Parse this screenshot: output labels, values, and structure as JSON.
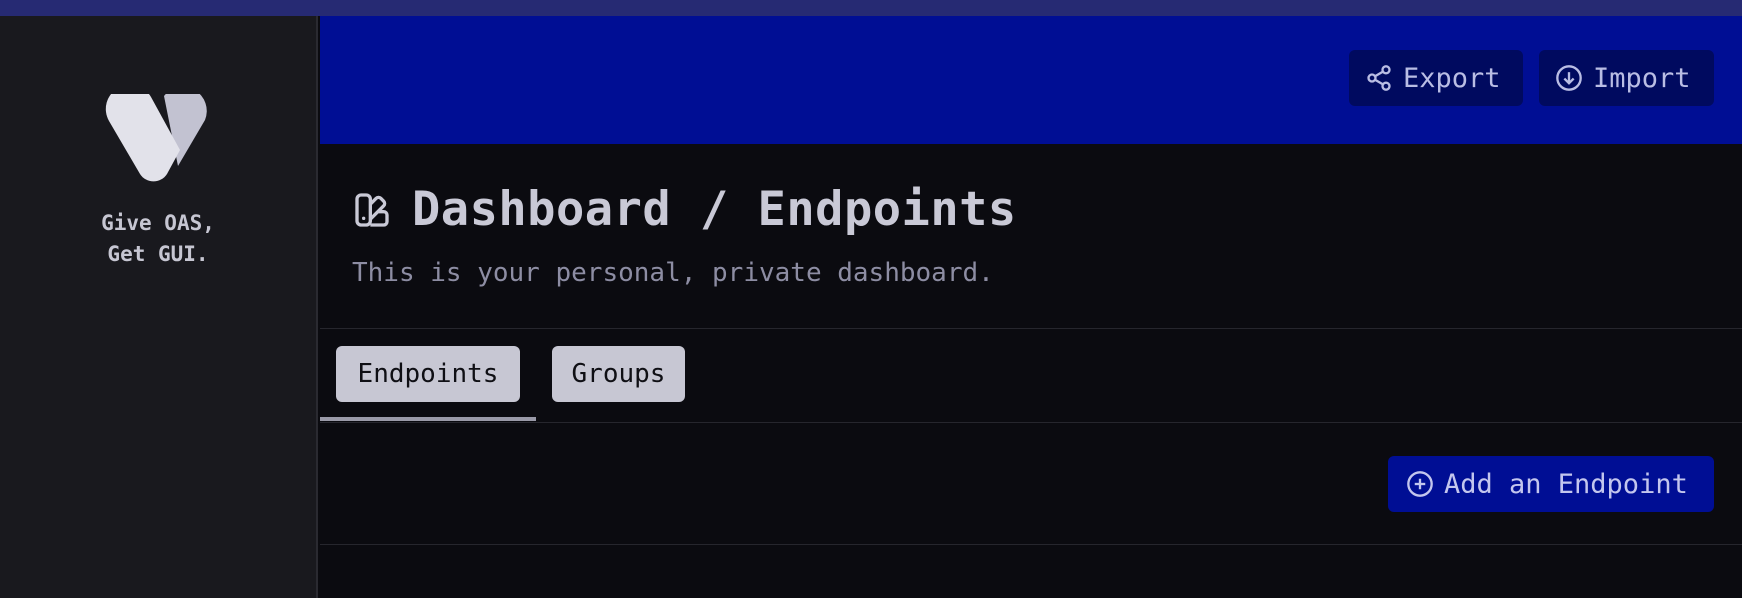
{
  "sidebar": {
    "tagline_line1": "Give OAS,",
    "tagline_line2": "Get GUI."
  },
  "header": {
    "export_label": "Export",
    "import_label": "Import"
  },
  "page": {
    "title": "Dashboard / Endpoints",
    "subtitle": "This is your personal, private dashboard."
  },
  "tabs": [
    {
      "label": "Endpoints",
      "active": true
    },
    {
      "label": "Groups",
      "active": false
    }
  ],
  "actions": {
    "add_endpoint_label": "Add an Endpoint"
  },
  "icons": {
    "export": "share-icon",
    "import": "download-circle-icon",
    "title": "swatch-icon",
    "add": "plus-circle-icon"
  },
  "colors": {
    "header_bg": "#000e94",
    "sidebar_bg": "#19191e",
    "main_bg": "#0b0b10",
    "button_bg": "#000a5f",
    "accent": "#000e94",
    "tab_bg": "#c7c7d3"
  }
}
